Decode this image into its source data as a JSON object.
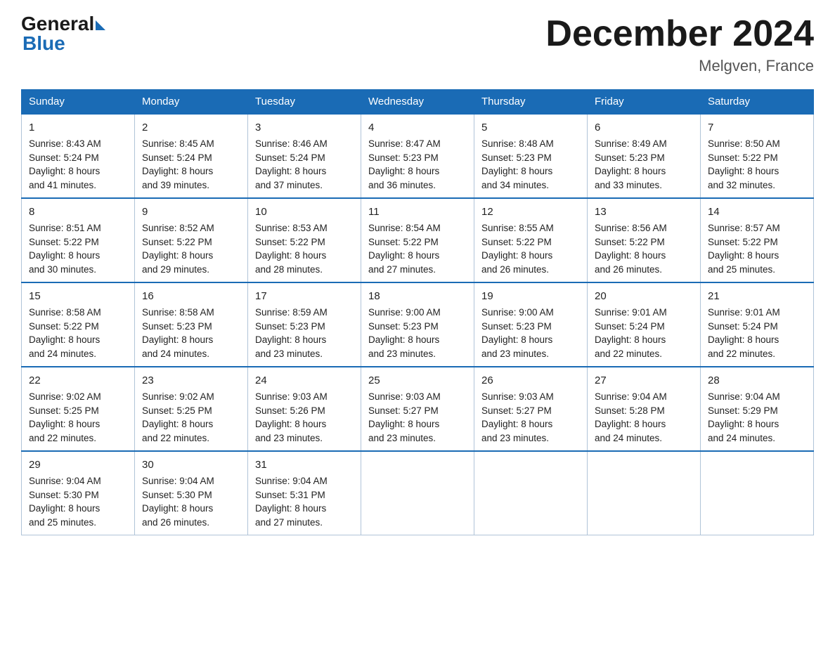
{
  "header": {
    "logo_general": "General",
    "logo_blue": "Blue",
    "month_title": "December 2024",
    "location": "Melgven, France"
  },
  "days_of_week": [
    "Sunday",
    "Monday",
    "Tuesday",
    "Wednesday",
    "Thursday",
    "Friday",
    "Saturday"
  ],
  "weeks": [
    [
      {
        "day": "1",
        "sunrise": "8:43 AM",
        "sunset": "5:24 PM",
        "daylight": "8 hours and 41 minutes."
      },
      {
        "day": "2",
        "sunrise": "8:45 AM",
        "sunset": "5:24 PM",
        "daylight": "8 hours and 39 minutes."
      },
      {
        "day": "3",
        "sunrise": "8:46 AM",
        "sunset": "5:24 PM",
        "daylight": "8 hours and 37 minutes."
      },
      {
        "day": "4",
        "sunrise": "8:47 AM",
        "sunset": "5:23 PM",
        "daylight": "8 hours and 36 minutes."
      },
      {
        "day": "5",
        "sunrise": "8:48 AM",
        "sunset": "5:23 PM",
        "daylight": "8 hours and 34 minutes."
      },
      {
        "day": "6",
        "sunrise": "8:49 AM",
        "sunset": "5:23 PM",
        "daylight": "8 hours and 33 minutes."
      },
      {
        "day": "7",
        "sunrise": "8:50 AM",
        "sunset": "5:22 PM",
        "daylight": "8 hours and 32 minutes."
      }
    ],
    [
      {
        "day": "8",
        "sunrise": "8:51 AM",
        "sunset": "5:22 PM",
        "daylight": "8 hours and 30 minutes."
      },
      {
        "day": "9",
        "sunrise": "8:52 AM",
        "sunset": "5:22 PM",
        "daylight": "8 hours and 29 minutes."
      },
      {
        "day": "10",
        "sunrise": "8:53 AM",
        "sunset": "5:22 PM",
        "daylight": "8 hours and 28 minutes."
      },
      {
        "day": "11",
        "sunrise": "8:54 AM",
        "sunset": "5:22 PM",
        "daylight": "8 hours and 27 minutes."
      },
      {
        "day": "12",
        "sunrise": "8:55 AM",
        "sunset": "5:22 PM",
        "daylight": "8 hours and 26 minutes."
      },
      {
        "day": "13",
        "sunrise": "8:56 AM",
        "sunset": "5:22 PM",
        "daylight": "8 hours and 26 minutes."
      },
      {
        "day": "14",
        "sunrise": "8:57 AM",
        "sunset": "5:22 PM",
        "daylight": "8 hours and 25 minutes."
      }
    ],
    [
      {
        "day": "15",
        "sunrise": "8:58 AM",
        "sunset": "5:22 PM",
        "daylight": "8 hours and 24 minutes."
      },
      {
        "day": "16",
        "sunrise": "8:58 AM",
        "sunset": "5:23 PM",
        "daylight": "8 hours and 24 minutes."
      },
      {
        "day": "17",
        "sunrise": "8:59 AM",
        "sunset": "5:23 PM",
        "daylight": "8 hours and 23 minutes."
      },
      {
        "day": "18",
        "sunrise": "9:00 AM",
        "sunset": "5:23 PM",
        "daylight": "8 hours and 23 minutes."
      },
      {
        "day": "19",
        "sunrise": "9:00 AM",
        "sunset": "5:23 PM",
        "daylight": "8 hours and 23 minutes."
      },
      {
        "day": "20",
        "sunrise": "9:01 AM",
        "sunset": "5:24 PM",
        "daylight": "8 hours and 22 minutes."
      },
      {
        "day": "21",
        "sunrise": "9:01 AM",
        "sunset": "5:24 PM",
        "daylight": "8 hours and 22 minutes."
      }
    ],
    [
      {
        "day": "22",
        "sunrise": "9:02 AM",
        "sunset": "5:25 PM",
        "daylight": "8 hours and 22 minutes."
      },
      {
        "day": "23",
        "sunrise": "9:02 AM",
        "sunset": "5:25 PM",
        "daylight": "8 hours and 22 minutes."
      },
      {
        "day": "24",
        "sunrise": "9:03 AM",
        "sunset": "5:26 PM",
        "daylight": "8 hours and 23 minutes."
      },
      {
        "day": "25",
        "sunrise": "9:03 AM",
        "sunset": "5:27 PM",
        "daylight": "8 hours and 23 minutes."
      },
      {
        "day": "26",
        "sunrise": "9:03 AM",
        "sunset": "5:27 PM",
        "daylight": "8 hours and 23 minutes."
      },
      {
        "day": "27",
        "sunrise": "9:04 AM",
        "sunset": "5:28 PM",
        "daylight": "8 hours and 24 minutes."
      },
      {
        "day": "28",
        "sunrise": "9:04 AM",
        "sunset": "5:29 PM",
        "daylight": "8 hours and 24 minutes."
      }
    ],
    [
      {
        "day": "29",
        "sunrise": "9:04 AM",
        "sunset": "5:30 PM",
        "daylight": "8 hours and 25 minutes."
      },
      {
        "day": "30",
        "sunrise": "9:04 AM",
        "sunset": "5:30 PM",
        "daylight": "8 hours and 26 minutes."
      },
      {
        "day": "31",
        "sunrise": "9:04 AM",
        "sunset": "5:31 PM",
        "daylight": "8 hours and 27 minutes."
      },
      null,
      null,
      null,
      null
    ]
  ],
  "labels": {
    "sunrise": "Sunrise:",
    "sunset": "Sunset:",
    "daylight": "Daylight:"
  }
}
